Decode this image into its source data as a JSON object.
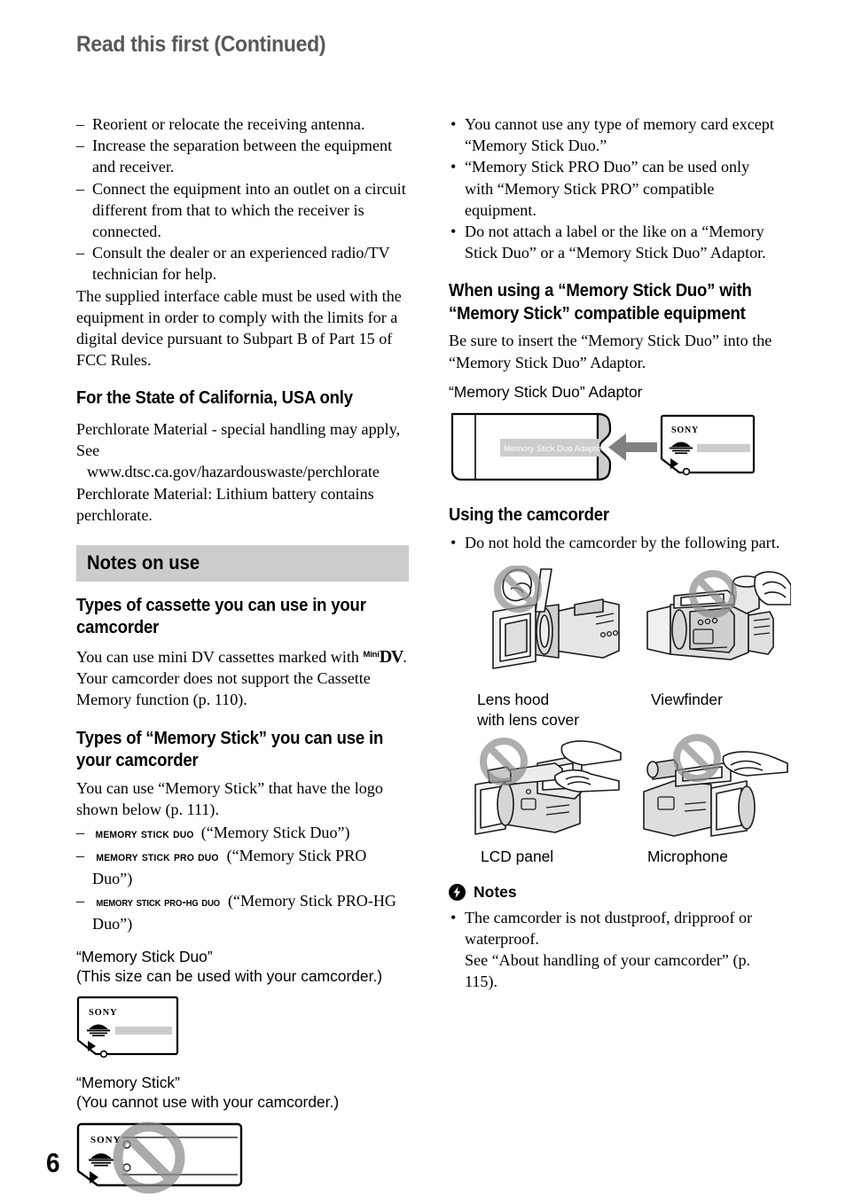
{
  "page": {
    "title": "Read this first (Continued)",
    "number": "6"
  },
  "left_column": {
    "fcc_list": [
      "Reorient or relocate the receiving antenna.",
      "Increase the separation between the equipment and receiver.",
      "Connect the equipment into an outlet on a circuit different from that to which the receiver is connected.",
      "Consult the dealer or an experienced radio/TV technician for help."
    ],
    "fcc_paragraph": "The supplied interface cable must be used with the equipment in order to comply with the limits for a digital device pursuant to Subpart B of Part 15 of FCC Rules.",
    "california_heading": "For the State of California, USA only",
    "california_lines": [
      "Perchlorate Material - special handling may apply, See",
      "www.dtsc.ca.gov/hazardouswaste/perchlorate",
      "Perchlorate Material: Lithium battery contains perchlorate."
    ],
    "section_band": "Notes on use",
    "cassette_heading": "Types of cassette you can use in your camcorder",
    "cassette_text_1": "You can use mini DV cassettes marked with ",
    "minidv_mini": "Mini",
    "minidv_dv": "DV",
    "cassette_text_2": ". Your camcorder does not support the Cassette Memory function (p. 110).",
    "memorystick_heading": "Types of “Memory Stick” you can use in your camcorder",
    "memorystick_intro": "You can use “Memory Stick” that have the logo shown below (p. 111).",
    "memorystick_types": [
      {
        "logo": "Memory Stick Duo",
        "name": "(“Memory Stick Duo”)"
      },
      {
        "logo": "Memory Stick PRO Duo",
        "name": "(“Memory Stick PRO Duo”)"
      },
      {
        "logo": "Memory Stick PRO-HG Duo",
        "name": "(“Memory Stick PRO-HG Duo”)"
      }
    ],
    "duo_caption_line1": "“Memory Stick Duo”",
    "duo_caption_line2": "(This size can be used with your camcorder.)",
    "full_caption_line1": "“Memory Stick”",
    "full_caption_line2": "(You cannot use with your camcorder.)",
    "card_brand": "SONY"
  },
  "right_column": {
    "memory_notes": [
      "You cannot use any type of memory card except “Memory Stick Duo.”",
      "“Memory Stick PRO Duo” can be used only with “Memory Stick PRO” compatible equipment.",
      "Do not attach a label or the like on a “Memory Stick Duo” or a “Memory Stick Duo” Adaptor."
    ],
    "adaptor_heading": "When using a “Memory Stick Duo” with “Memory Stick” compatible equipment",
    "adaptor_text": "Be sure to insert the “Memory Stick Duo” into the “Memory Stick Duo” Adaptor.",
    "adaptor_caption": "“Memory Stick Duo” Adaptor",
    "adaptor_label": "Memory Stick Duo Adaptor",
    "card_brand": "SONY",
    "using_heading": "Using the camcorder",
    "using_bullet": "Do not hold the camcorder by the following part.",
    "parts": [
      "Lens hood\nwith lens cover",
      "Viewfinder",
      "LCD panel",
      "Microphone"
    ],
    "part_labels": {
      "lens_hood_line1": "Lens hood",
      "lens_hood_line2": "with lens cover",
      "viewfinder": "Viewfinder",
      "lcd_panel": "LCD panel",
      "microphone": "Microphone"
    },
    "notes_heading": "Notes",
    "notes_items": [
      "The camcorder is not dustproof, dripproof or waterproof.\nSee “About handling of your camcorder” (p. 115)."
    ],
    "notes_item_1_line1": "The camcorder is not dustproof, dripproof or waterproof.",
    "notes_item_1_line2": "See “About handling of your camcorder” (p. 115)."
  },
  "colors": {
    "title_gray": "#58585a",
    "band_gray": "#cccccc",
    "prohibition_gray": "#8c8c8c",
    "arrow_gray": "#808080",
    "card_bar_gray": "#cccccc"
  }
}
